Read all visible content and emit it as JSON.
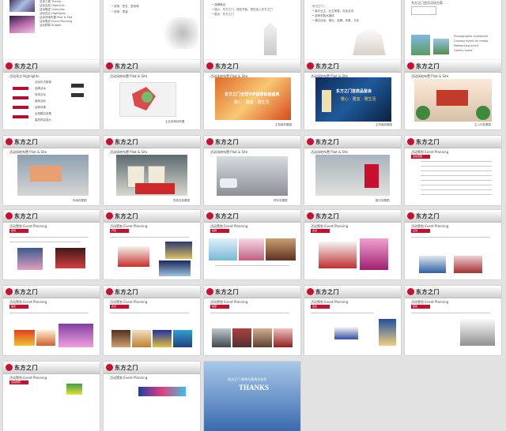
{
  "logo_text": "东方之门",
  "slides": {
    "s1": {
      "items": [
        "总体工程 Theme",
        "活动目标 Objective",
        "活动概述 Overview",
        "活动亮点 Highlights",
        "活动场地布置 Pilot & Site",
        "活动策划 Event Planning",
        "活动预算 Budget"
      ]
    },
    "s2": {
      "lines": [
        "• 现场：签名、签到墙",
        "• 现场：表演"
      ]
    },
    "s3": {
      "lines": [
        "• 品牌输出",
        "• 核心：东方之门，现在开始，现在走入东方之门",
        "• 推出：东方之门"
      ]
    },
    "s4": {
      "lines": [
        "东方之门 ...",
        "• 吸引业主、业主家属、社会名流",
        "• 延伸到各大媒体",
        "• 通过活动，推出：品牌、形象、文化"
      ]
    },
    "s5": {
      "title": "东方之门会员活动方案 ...",
      "rows": [
        "Photographer scheduled",
        "Outdoor event for media",
        "Networking event",
        "Gallery event"
      ]
    },
    "s6": {
      "title": "活动亮点 Highlights",
      "labels": [
        "亮点一",
        "亮点二",
        "亮点三",
        "亮点四",
        "亮点五"
      ],
      "items": [
        "活动形式新颖",
        "品牌活动",
        "现场互动",
        "媒体活动",
        "延伸效果",
        "全城瞩目效果",
        "嘉宾阵容强大"
      ]
    },
    "s7": {
      "title": "活动场地布置 Pilot & Site",
      "caption": "主会场场地布置"
    },
    "s8": {
      "title": "活动场地布置 Pilot & Site",
      "banner_title": "东方之门全球VIP首席体验盛典",
      "banner_sub": "雅心 · 雅室 · 雅生活",
      "caption": "主背景效果图"
    },
    "s9": {
      "title": "活动场地布置 Pilot & Site",
      "banner_title": "东方之门首席品鉴会",
      "banner_sub": "雅心 · 雅室 · 雅生活",
      "caption": "主背景效果图"
    },
    "s10": {
      "title": "活动场地布置 Pilot & Site",
      "caption": "主入口效果图"
    },
    "s11": {
      "title": "活动场地布置 Pilot & Site",
      "caption": "场地效果图"
    },
    "s12": {
      "title": "活动场地布置 Pilot & Site",
      "caption": "签到区效果图"
    },
    "s13": {
      "title": "活动场地布置 Pilot & Site",
      "caption": "停车效果图"
    },
    "s14": {
      "title": "活动场地布置 Pilot & Site",
      "caption": "路引效果图"
    },
    "s15": {
      "title": "活动策划 Event Planning",
      "tag": "活动流程"
    },
    "s16": {
      "title": "活动策划 Event Planning",
      "tag": "暖场"
    },
    "s17": {
      "title": "活动策划 Event Planning",
      "tag": "开场"
    },
    "s18": {
      "title": "活动策划 Event Planning",
      "tag": "致辞"
    },
    "s19": {
      "title": "活动策划 Event Planning",
      "tag": "表演"
    },
    "s20": {
      "title": "活动策划 Event Planning",
      "tag": "互动"
    },
    "s21": {
      "title": "活动策划 Event Planning",
      "tag": "抽奖"
    },
    "s22": {
      "title": "活动策划 Event Planning",
      "tag": "表演"
    },
    "s23": {
      "title": "活动策划 Event Planning",
      "tag": "晚宴"
    },
    "s24": {
      "title": "活动策划 Event Planning",
      "tag": "签名"
    },
    "s25": {
      "title": "活动策划 Event Planning",
      "tag": "结束"
    },
    "s26": {
      "title": "活动策划 Event Planning",
      "tag": "活动预算"
    },
    "s27": {
      "title": "活动策划 Event Planning"
    },
    "s28": {
      "thanks": "THANKS",
      "line": "东方之门 期待与您再次合作"
    }
  },
  "colors": {
    "brand_red": "#c8102e",
    "bg": "#e2e2e2"
  }
}
